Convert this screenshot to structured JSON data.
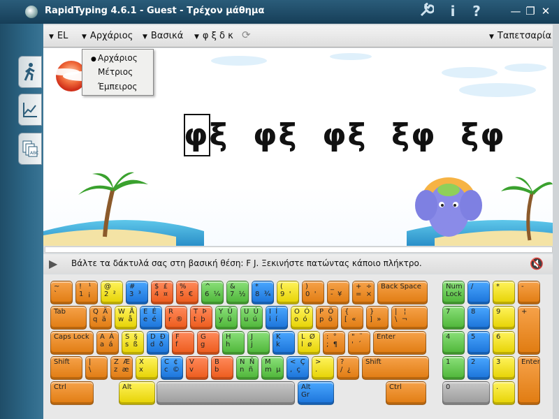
{
  "window": {
    "title": "RapidTyping 4.6.1 - Guest - Τρέχον μάθημα",
    "settings_icon": "wrench-icon",
    "info_label": "i",
    "help_label": "?",
    "minimize_label": "—",
    "restore_label": "❐",
    "close_label": "✕"
  },
  "menubar": {
    "items": [
      {
        "label": "EL"
      },
      {
        "label": "Αρχάριος"
      },
      {
        "label": "Βασικά"
      },
      {
        "label": "φ ξ δ κ"
      }
    ],
    "right_item": "Ταπετσαρία"
  },
  "dropdown": {
    "options": [
      "Αρχάριος",
      "Μέτριος",
      "Έμπειρος"
    ],
    "selected_index": 0
  },
  "lesson": {
    "text": "φξ  φξ  φξ  ξφ  ξφ"
  },
  "hint": {
    "text": "Βάλτε τα δάκτυλά σας στη βασική θέση:  F J.  Ξεκινήστε πατώντας κάποιο πλήκτρο."
  },
  "colors": {
    "orange": "#e88a25",
    "yellow": "#f2e21e",
    "green": "#5fc34a",
    "blue": "#2585ec",
    "red": "#f06a30",
    "titlebar": "#1f4d68"
  },
  "keyboard": {
    "rows": [
      [
        {
          "id": "k-tilde",
          "label": "~\n`",
          "c": "or"
        },
        {
          "id": "k-1",
          "label": "!   ¹\n1  ¡",
          "c": "or"
        },
        {
          "id": "k-2",
          "label": "@\n2  ²",
          "c": "ye"
        },
        {
          "id": "k-3",
          "label": "#\n3  ³",
          "c": "bl"
        },
        {
          "id": "k-4",
          "label": "$  £\n4  ¤",
          "c": "rd"
        },
        {
          "id": "k-5",
          "label": "%\n5  €",
          "c": "rd"
        },
        {
          "id": "k-6",
          "label": "^\n6  ¼",
          "c": "gr"
        },
        {
          "id": "k-7",
          "label": "&\n7  ½",
          "c": "gr"
        },
        {
          "id": "k-8",
          "label": "*\n8  ¾",
          "c": "bl"
        },
        {
          "id": "k-9",
          "label": "(\n9  '",
          "c": "ye"
        },
        {
          "id": "k-0",
          "label": ")\n0  '",
          "c": "or"
        },
        {
          "id": "k-minus",
          "label": "_\n-  ¥",
          "c": "or"
        },
        {
          "id": "k-equals",
          "label": "+  ÷\n=  ×",
          "c": "or"
        },
        {
          "id": "k-backspace",
          "label": "Back Space",
          "c": "or"
        }
      ],
      [
        {
          "id": "k-tab",
          "label": "Tab",
          "c": "or"
        },
        {
          "id": "k-q",
          "label": "Q  Ä\nq  ä",
          "c": "or"
        },
        {
          "id": "k-w",
          "label": "W  Å\nw  å",
          "c": "ye"
        },
        {
          "id": "k-e",
          "label": "E  É\ne  é",
          "c": "bl"
        },
        {
          "id": "k-r",
          "label": "R\nr  ®",
          "c": "rd"
        },
        {
          "id": "k-t",
          "label": "T  Þ\nt  þ",
          "c": "rd"
        },
        {
          "id": "k-y",
          "label": "Y  Ü\ny  ü",
          "c": "gr"
        },
        {
          "id": "k-u",
          "label": "U  Ú\nu  ú",
          "c": "gr"
        },
        {
          "id": "k-i",
          "label": "I  Í\ni  í",
          "c": "bl"
        },
        {
          "id": "k-o",
          "label": "O  Ó\no  ó",
          "c": "ye"
        },
        {
          "id": "k-p",
          "label": "P  Ö\np  ö",
          "c": "or"
        },
        {
          "id": "k-lbracket",
          "label": "{\n[  «",
          "c": "or"
        },
        {
          "id": "k-rbracket",
          "label": "}\n]  »",
          "c": "or"
        },
        {
          "id": "k-backslash",
          "label": "|   ¦\n\\  ¬",
          "c": "or"
        }
      ],
      [
        {
          "id": "k-caps",
          "label": "Caps Lock",
          "c": "or"
        },
        {
          "id": "k-a",
          "label": "A  Á\na  á",
          "c": "or"
        },
        {
          "id": "k-s",
          "label": "S  §\ns  ß",
          "c": "ye"
        },
        {
          "id": "k-d",
          "label": "D  Ð\nd  ð",
          "c": "bl"
        },
        {
          "id": "k-f",
          "label": "F\nf",
          "c": "rd"
        },
        {
          "id": "k-g",
          "label": "G\ng",
          "c": "rd"
        },
        {
          "id": "k-h",
          "label": "H\nh",
          "c": "gr"
        },
        {
          "id": "k-j",
          "label": "J\nj",
          "c": "gr"
        },
        {
          "id": "k-k",
          "label": "K\nk",
          "c": "bl"
        },
        {
          "id": "k-l",
          "label": "L  Ø\nl  ø",
          "c": "ye"
        },
        {
          "id": "k-semicolon",
          "label": ":  °\n;  ¶",
          "c": "or"
        },
        {
          "id": "k-quote",
          "label": "\"  ¨\n'  ´",
          "c": "or"
        },
        {
          "id": "k-enter",
          "label": "Enter",
          "c": "or"
        }
      ],
      [
        {
          "id": "k-lshift",
          "label": "Shift",
          "c": "or"
        },
        {
          "id": "k-oem102",
          "label": "|\n\\",
          "c": "or"
        },
        {
          "id": "k-z",
          "label": "Z  Æ\nz  æ",
          "c": "or"
        },
        {
          "id": "k-x",
          "label": "X\nx",
          "c": "ye"
        },
        {
          "id": "k-c",
          "label": "C  ¢\nc  ©",
          "c": "bl"
        },
        {
          "id": "k-v",
          "label": "V\nv",
          "c": "rd"
        },
        {
          "id": "k-b",
          "label": "B\nb",
          "c": "rd"
        },
        {
          "id": "k-n",
          "label": "N  Ñ\nn  ñ",
          "c": "gr"
        },
        {
          "id": "k-m",
          "label": "M\nm  µ",
          "c": "gr"
        },
        {
          "id": "k-comma",
          "label": "<  Ç\n,  ç",
          "c": "bl"
        },
        {
          "id": "k-period",
          "label": ">\n.",
          "c": "ye"
        },
        {
          "id": "k-slash",
          "label": "?\n/  ¿",
          "c": "or"
        },
        {
          "id": "k-rshift",
          "label": "Shift",
          "c": "or"
        }
      ],
      [
        {
          "id": "k-lctrl",
          "label": "Ctrl",
          "c": "or"
        },
        {
          "id": "k-lalt",
          "label": "Alt",
          "c": "ye"
        },
        {
          "id": "k-space",
          "label": "",
          "c": "gy"
        },
        {
          "id": "k-altgr",
          "label": "Alt\nGr",
          "c": "bl"
        },
        {
          "id": "k-rctrl",
          "label": "Ctrl",
          "c": "or"
        }
      ]
    ],
    "numpad": [
      {
        "id": "np-numlock",
        "label": "Num\nLock",
        "c": "gr"
      },
      {
        "id": "np-div",
        "label": "/",
        "c": "bl"
      },
      {
        "id": "np-mul",
        "label": "*",
        "c": "ye"
      },
      {
        "id": "np-minus",
        "label": "-",
        "c": "or"
      },
      {
        "id": "np-7",
        "label": "7",
        "c": "gr"
      },
      {
        "id": "np-8",
        "label": "8",
        "c": "bl"
      },
      {
        "id": "np-9",
        "label": "9",
        "c": "ye"
      },
      {
        "id": "np-plus",
        "label": "+",
        "c": "or"
      },
      {
        "id": "np-4",
        "label": "4",
        "c": "gr"
      },
      {
        "id": "np-5",
        "label": "5",
        "c": "bl"
      },
      {
        "id": "np-6",
        "label": "6",
        "c": "ye"
      },
      {
        "id": "np-1",
        "label": "1",
        "c": "gr"
      },
      {
        "id": "np-2",
        "label": "2",
        "c": "bl"
      },
      {
        "id": "np-3",
        "label": "3",
        "c": "ye"
      },
      {
        "id": "np-enter",
        "label": "Enter",
        "c": "or"
      },
      {
        "id": "np-0",
        "label": "0",
        "c": "gy"
      },
      {
        "id": "np-dot",
        "label": ".",
        "c": "ye"
      }
    ]
  }
}
